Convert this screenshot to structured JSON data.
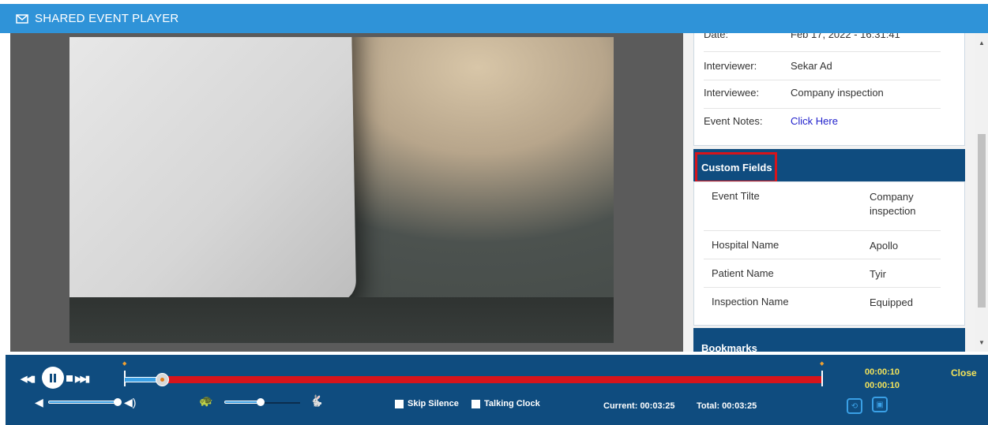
{
  "header": {
    "title": "SHARED EVENT PLAYER",
    "icon": "mail-icon"
  },
  "info": {
    "rows": [
      {
        "label": "Date:",
        "value": "Feb 17, 2022 - 16:31:41"
      },
      {
        "label": "Interviewer:",
        "value": "Sekar Ad"
      },
      {
        "label": "Interviewee:",
        "value": "Company inspection"
      },
      {
        "label": "Event Notes:",
        "value": "Click Here"
      }
    ]
  },
  "custom_fields": {
    "title": "Custom Fields",
    "rows": [
      {
        "label": "Event Tilte",
        "value_line1": "Company",
        "value_line2": "inspection"
      },
      {
        "label": "Hospital Name",
        "value": "Apollo"
      },
      {
        "label": "Patient Name",
        "value": "Tyir"
      },
      {
        "label": "Inspection Name",
        "value": "Equipped"
      }
    ]
  },
  "bookmarks": {
    "title": "Bookmarks"
  },
  "player": {
    "skip_silence": "Skip Silence",
    "talking_clock": "Talking Clock",
    "current": "Current: 00:03:25",
    "total": "Total: 00:03:25",
    "marker_time_1": "00:00:10",
    "marker_time_2": "00:00:10",
    "close": "Close",
    "progress_fraction": 0.06
  },
  "colors": {
    "header": "#2f93d8",
    "panel_header": "#0f4c7f",
    "highlight": "#d7141b",
    "timeline": "#d7141b",
    "time_text": "#f4e45a"
  }
}
